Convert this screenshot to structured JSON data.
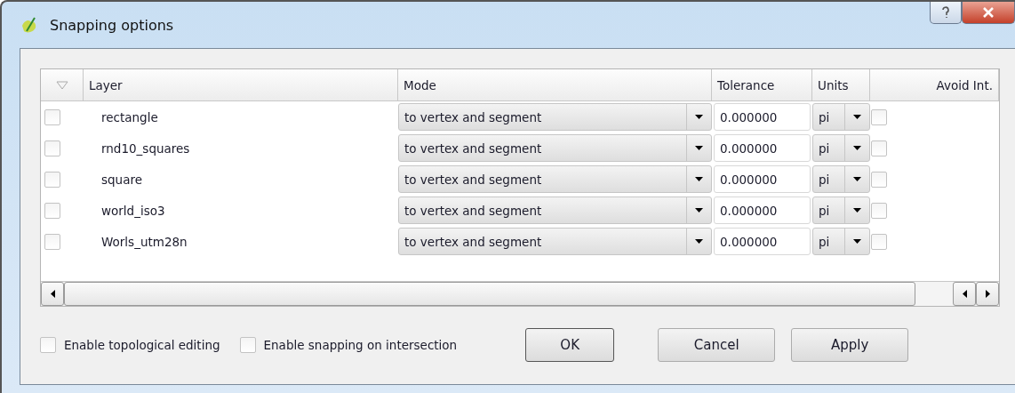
{
  "window": {
    "title": "Snapping options"
  },
  "table": {
    "columns": [
      "Layer",
      "Mode",
      "Tolerance",
      "Units",
      "Avoid Int."
    ],
    "rows": [
      {
        "checked": false,
        "layer": "rectangle",
        "mode": "to vertex and segment",
        "tolerance": "0.000000",
        "units": "pi",
        "avoid": false
      },
      {
        "checked": false,
        "layer": "rnd10_squares",
        "mode": "to vertex and segment",
        "tolerance": "0.000000",
        "units": "pi",
        "avoid": false
      },
      {
        "checked": false,
        "layer": "square",
        "mode": "to vertex and segment",
        "tolerance": "0.000000",
        "units": "pi",
        "avoid": false
      },
      {
        "checked": false,
        "layer": "world_iso3",
        "mode": "to vertex and segment",
        "tolerance": "0.000000",
        "units": "pi",
        "avoid": false
      },
      {
        "checked": false,
        "layer": "Worls_utm28n",
        "mode": "to vertex and segment",
        "tolerance": "0.000000",
        "units": "pi",
        "avoid": false
      }
    ]
  },
  "options": [
    {
      "label": "Enable topological editing",
      "checked": false
    },
    {
      "label": "Enable snapping on intersection",
      "checked": false
    }
  ],
  "buttons": [
    {
      "label": "OK",
      "default": true
    },
    {
      "label": "Cancel",
      "default": false
    },
    {
      "label": "Apply",
      "default": false
    }
  ]
}
